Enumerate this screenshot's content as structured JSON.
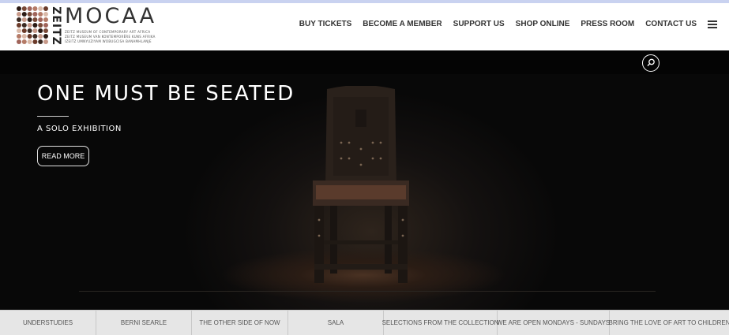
{
  "brand": {
    "zeitz": "ZEITZ",
    "name": "MOCAA",
    "subtitle_lines": [
      "ZEITZ MUSEUM OF CONTEMPORARY ART AFRICA",
      "ZEITZ MUSEUM VAN KONTEMPORÊRE KUNS AFRIKA",
      "IZEITZ UMNYUZIYAM WOBUGCISA BANAMHLANJE"
    ]
  },
  "nav": {
    "items": [
      "BUY TICKETS",
      "BECOME A MEMBER",
      "SUPPORT US",
      "SHOP ONLINE",
      "PRESS ROOM",
      "CONTACT US"
    ],
    "menu_icon": "hamburger-menu-icon"
  },
  "hero": {
    "title": "ONE MUST BE SEATED",
    "subtitle": "A SOLO EXHIBITION",
    "button_label": "READ MORE",
    "search_icon": "search-icon"
  },
  "tabs": [
    "UNDERSTUDIES",
    "BERNI SEARLE",
    "THE OTHER SIDE OF NOW",
    "SALA",
    "SELECTIONS FROM THE COLLECTION",
    "WE ARE OPEN MONDAYS - SUNDAYS",
    "BRING THE LOVE OF ART TO CHILDREN"
  ],
  "colors": {
    "nav_text": "#333333",
    "hero_background": "#0b0b0b",
    "tab_bar": "#e6e6e6"
  }
}
